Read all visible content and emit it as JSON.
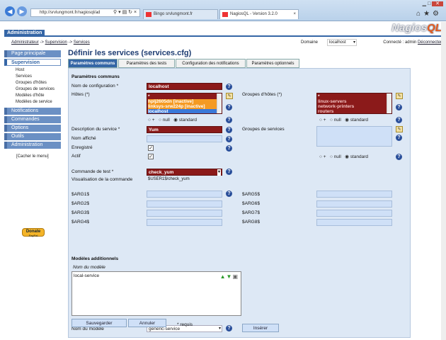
{
  "browser": {
    "url": "http://srvlungmont.fr/nagiosql/ad",
    "tabs": [
      {
        "label": "Bingo srvlungmont.fr"
      },
      {
        "label": "NagiosQL - Version 3.2.0"
      }
    ]
  },
  "header": {
    "section_label": "Administration",
    "logo_left": "Nagios",
    "logo_right": "QL",
    "breadcrumb": [
      "Administrateur",
      "Supervision",
      "Services"
    ],
    "breadcrumb_sep": "->",
    "domain_label": "Domaine",
    "domain_value": "localhost",
    "connected_label": "Connecté : admin",
    "logout_label": "Déconnecter"
  },
  "sidebar": {
    "items": [
      {
        "label": "Page principale",
        "selected": false
      },
      {
        "label": "Supervision",
        "selected": true
      },
      {
        "label": "Notifications",
        "selected": false
      },
      {
        "label": "Commandes",
        "selected": false
      },
      {
        "label": "Options",
        "selected": false
      },
      {
        "label": "Outils",
        "selected": false
      },
      {
        "label": "Administration",
        "selected": false
      }
    ],
    "sub_items": [
      "Host",
      "Services",
      "Groupes d'hôtes",
      "Groupes de services",
      "Modèles d'hôte",
      "Modèles de service"
    ],
    "hide_menu": "[Cacher le menu]",
    "donate_label": "Donate",
    "donate_sub": "PayPal"
  },
  "main": {
    "title": "Définir les services (services.cfg)",
    "tabs": [
      "Paramètres communs",
      "Paramètres des tests",
      "Configuration des notifications",
      "Paramètres optionnels"
    ],
    "section_common": "Paramètres communs",
    "config_name_label": "Nom de configuration *",
    "config_name_value": "localhost",
    "hosts_label": "Hôtes (*)",
    "hosts_options": [
      "*",
      "hplj2605dn [inactive]",
      "linksys-srw224p [inactive]",
      "localhost"
    ],
    "hostgroups_label": "Groupes d'hôtes (*)",
    "hostgroups_options": [
      "*",
      "linux-servers",
      "network-printers",
      "routers"
    ],
    "radio_plus": "+",
    "radio_null": "null",
    "radio_standard": "standard",
    "service_desc_label": "Description du service *",
    "service_desc_value": "Yum",
    "servicegroups_label": "Groupes de services",
    "display_name_label": "Nom affiché",
    "registered_label": "Enregistré",
    "active_label": "Actif",
    "check_cmd_label": "Commande de test *",
    "check_cmd_value": "check_yum",
    "cmd_view_label": "Visualisation de la commande",
    "cmd_view_value": "$USER1$/check_yum",
    "args_left": [
      "$ARG1$",
      "$ARG2$",
      "$ARG3$",
      "$ARG4$"
    ],
    "args_right": [
      "$ARG5$",
      "$ARG6$",
      "$ARG7$",
      "$ARG8$"
    ],
    "section_templates": "Modèles additionnels",
    "template_header": "Nom du modèle",
    "template_items": [
      "local-service"
    ],
    "template_name_label": "Nom du modèle",
    "template_select": "generic-service",
    "insert_button": "Insérer",
    "save_button": "Sauvegarder",
    "cancel_button": "Annuler",
    "required_note": "* requis"
  }
}
